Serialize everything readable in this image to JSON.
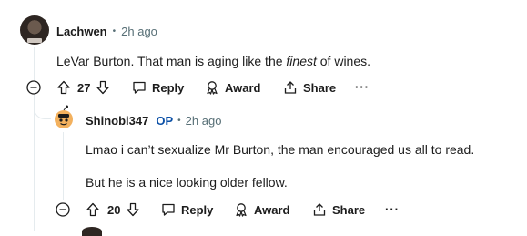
{
  "comments": [
    {
      "author": "Lachwen",
      "time": "2h ago",
      "body_prefix": "LeVar Burton.  That man is aging like the ",
      "body_em": "finest",
      "body_suffix": " of wines.",
      "votes": "27",
      "actions": {
        "reply": "Reply",
        "award": "Award",
        "share": "Share"
      }
    },
    {
      "author": "Shinobi347",
      "op_badge": "OP",
      "time": "2h ago",
      "body_lines": [
        "Lmao i can’t sexualize Mr Burton, the man encouraged us all to read.",
        "But he is a nice looking older fellow."
      ],
      "votes": "20",
      "actions": {
        "reply": "Reply",
        "award": "Award",
        "share": "Share"
      }
    }
  ],
  "separator": "•",
  "more_glyph": "···",
  "icons": [
    "upvote-icon",
    "downvote-icon",
    "reply-icon",
    "award-icon",
    "share-icon",
    "more-icon",
    "collapse-icon"
  ]
}
